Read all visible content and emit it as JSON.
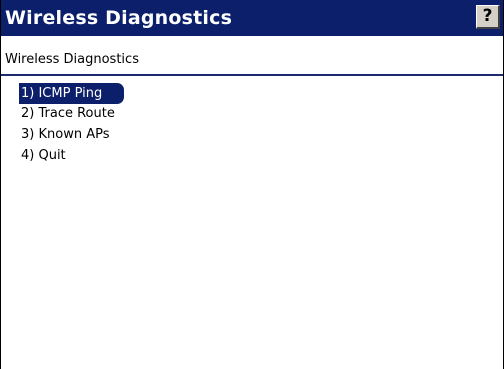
{
  "window": {
    "title": "Wireless Diagnostics",
    "help_label": "?"
  },
  "content": {
    "subtitle": "Wireless Diagnostics",
    "menu": [
      {
        "label": "1) ICMP Ping",
        "selected": true
      },
      {
        "label": "2) Trace Route",
        "selected": false
      },
      {
        "label": "3) Known APs",
        "selected": false
      },
      {
        "label": "4) Quit",
        "selected": false
      }
    ]
  },
  "colors": {
    "titlebar": "#0b1f6b",
    "selection": "#0b1f6b",
    "separator": "#1c2a6e"
  },
  "icons": {
    "help": "help-question-icon"
  }
}
